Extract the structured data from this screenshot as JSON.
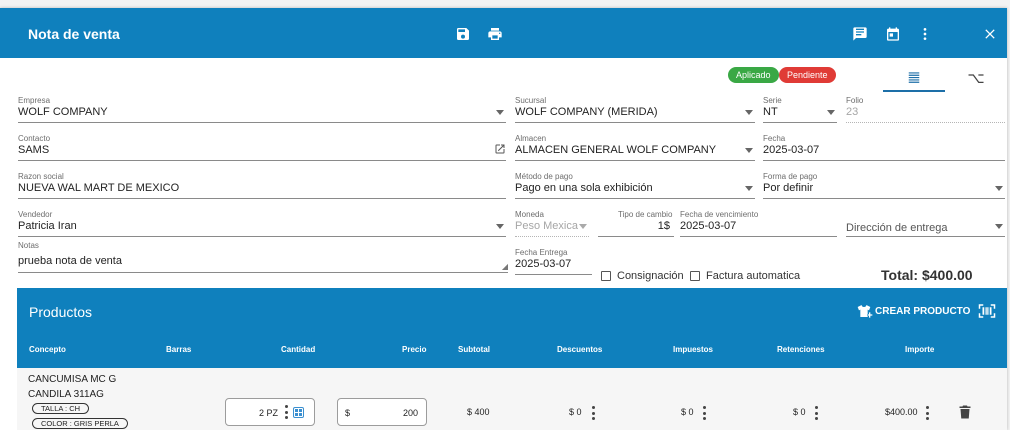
{
  "header": {
    "title": "Nota de venta"
  },
  "icons": {
    "save": "save-icon",
    "print": "print-icon",
    "notes": "notes-icon",
    "calendar": "calendar-icon",
    "more": "more-vert-icon",
    "close": "close-icon"
  },
  "status": {
    "aplicado": "Aplicado",
    "pendiente": "Pendiente",
    "aplicado_color": "#3aa845",
    "pendiente_color": "#e03b36"
  },
  "form": {
    "empresa": {
      "label": "Empresa",
      "value": "WOLF COMPANY"
    },
    "sucursal": {
      "label": "Sucursal",
      "value": "WOLF COMPANY (MERIDA)"
    },
    "serie": {
      "label": "Serie",
      "value": "NT"
    },
    "folio": {
      "label": "Folio",
      "value": "23"
    },
    "contacto": {
      "label": "Contacto",
      "value": "SAMS"
    },
    "almacen": {
      "label": "Almacen",
      "value": "ALMACEN GENERAL WOLF COMPANY"
    },
    "fecha": {
      "label": "Fecha",
      "value": "2025-03-07"
    },
    "razon_social": {
      "label": "Razon social",
      "value": "NUEVA WAL MART DE MEXICO"
    },
    "metodo_pago": {
      "label": "Método de pago",
      "value": "Pago en una sola exhibición"
    },
    "forma_pago": {
      "label": "Forma de pago",
      "value": "Por definir"
    },
    "vendedor": {
      "label": "Vendedor",
      "value": "Patricia Iran"
    },
    "moneda": {
      "label": "Moneda",
      "value": "Peso Mexica"
    },
    "tipo_cambio": {
      "label": "Tipo de cambio",
      "value": "1$"
    },
    "fecha_vencimiento": {
      "label": "Fecha de vencimiento",
      "value": "2025-03-07"
    },
    "direccion_entrega": {
      "placeholder": "Dirección de entrega"
    },
    "notas": {
      "label": "Notas",
      "value": "prueba nota de venta"
    },
    "fecha_entrega": {
      "label": "Fecha Entrega",
      "value": "2025-03-07"
    },
    "consignacion": "Consignación",
    "factura_automatica": "Factura automatica"
  },
  "total": "Total: $400.00",
  "products": {
    "title": "Productos",
    "crear_label": "CREAR PRODUCTO",
    "columns": [
      "Concepto",
      "Barras",
      "Cantidad",
      "Precio",
      "Subtotal",
      "Descuentos",
      "Impuestos",
      "Retenciones",
      "Importe"
    ],
    "rows": [
      {
        "concepto_line1": "CANCUMISA MC G",
        "concepto_line2": "CANDILA 311AG",
        "chips": [
          "TALLA : CH",
          "COLOR : GRIS PERLA"
        ],
        "cantidad": "2 PZ",
        "precio_prefix": "$",
        "precio": "200",
        "subtotal": "$ 400",
        "descuentos": "$ 0",
        "impuestos": "$ 0",
        "retenciones": "$ 0",
        "importe": "$400.00"
      }
    ]
  },
  "colors": {
    "primary": "#0f80bd"
  }
}
